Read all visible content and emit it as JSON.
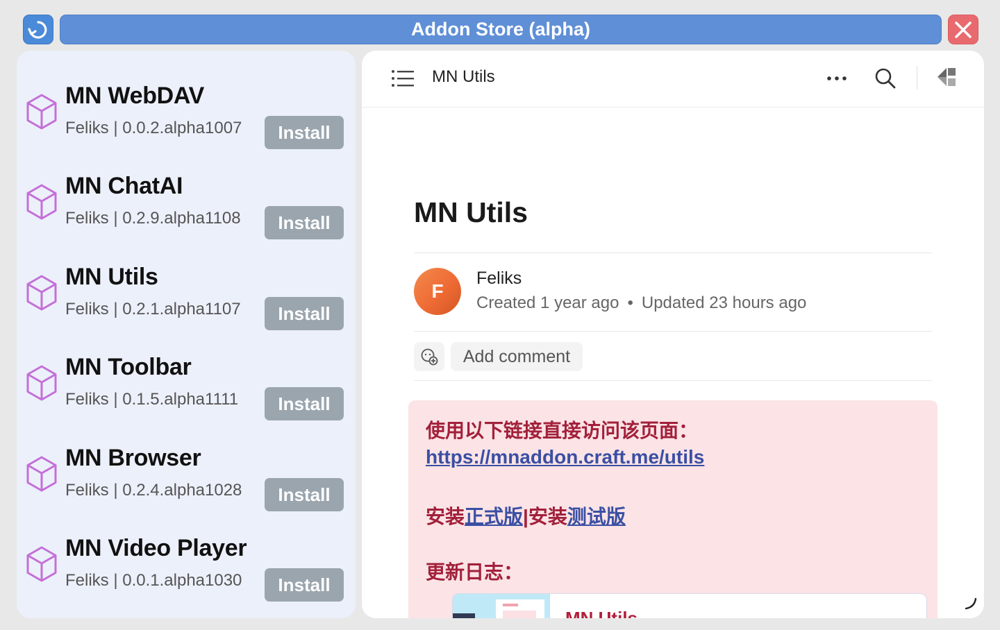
{
  "window": {
    "title": "Addon Store (alpha)"
  },
  "addons": [
    {
      "name": "MN WebDAV",
      "meta": "Feliks | 0.0.2.alpha1007",
      "button": "Install"
    },
    {
      "name": "MN ChatAI",
      "meta": "Feliks | 0.2.9.alpha1108",
      "button": "Install"
    },
    {
      "name": "MN Utils",
      "meta": "Feliks | 0.2.1.alpha1107",
      "button": "Install"
    },
    {
      "name": "MN Toolbar",
      "meta": "Feliks | 0.1.5.alpha1111",
      "button": "Install"
    },
    {
      "name": "MN Browser",
      "meta": "Feliks | 0.2.4.alpha1028",
      "button": "Install"
    },
    {
      "name": "MN Video Player",
      "meta": "Feliks | 0.0.1.alpha1030",
      "button": "Install"
    }
  ],
  "doc": {
    "topbar_title": "MN Utils",
    "title": "MN Utils",
    "author": "Feliks",
    "avatar_letter": "F",
    "created": "Created 1 year ago",
    "separator": "•",
    "updated": "Updated 23 hours ago",
    "add_comment": "Add comment",
    "callout": {
      "line1": "使用以下链接直接访问该页面：",
      "url": "https://mnaddon.craft.me/utils",
      "install_prefix": "安装",
      "install_stable": "正式版",
      "install_sep": "|安装",
      "install_beta": "测试版",
      "changelog": "更新日志：",
      "card_title": "MN Utils"
    }
  },
  "colors": {
    "titlebar": "#5f8fd6",
    "close": "#e96a6e",
    "left_panel": "#ecf0fa",
    "install_button": "#9aa5ae",
    "callout_bg": "#fbe3e6",
    "callout_text": "#a2203a",
    "link": "#3a4fa3",
    "addon_icon": "#c46fd8"
  }
}
